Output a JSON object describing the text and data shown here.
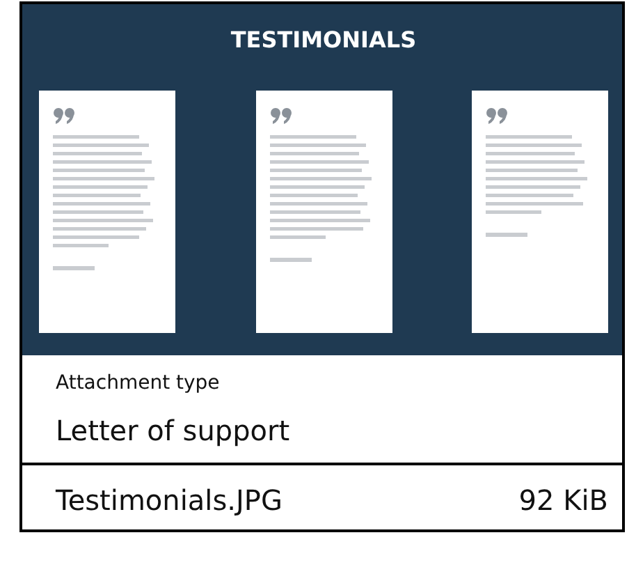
{
  "preview": {
    "title": "TESTIMONIALS"
  },
  "attachment_type": {
    "label": "Attachment type",
    "value": "Letter of support"
  },
  "file": {
    "name": "Testimonials.JPG",
    "size": "92 KiB"
  }
}
